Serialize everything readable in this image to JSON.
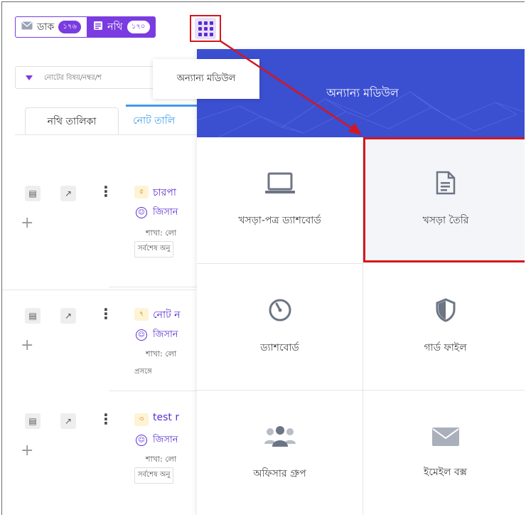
{
  "topbar": {
    "dak_label": "ডাক",
    "dak_count": "১৭৬",
    "nothi_label": "নথি",
    "nothi_count": "১৭০"
  },
  "search": {
    "placeholder": "নোটের বিষয়/নম্বর/শ"
  },
  "tabs": [
    {
      "label": "নথি তালিকা"
    },
    {
      "label": "নোট তালি"
    }
  ],
  "tooltip": {
    "text": "অন্যান্য মডিউল"
  },
  "notes": [
    {
      "num": "৫",
      "title": "চারপা",
      "person": "জিসান",
      "branch": "শাখা: লো",
      "last": "সর্বশেষ অনু"
    },
    {
      "num": "৭",
      "title": "নোট ন",
      "person": "জিসান",
      "branch": "শাখা: লো",
      "last": "প্রসঙ্গে"
    },
    {
      "num": "৩",
      "title": "test r",
      "person": "জিসান",
      "branch": "শাখা: লো",
      "last": "সর্বশেষ অনু"
    }
  ],
  "panel": {
    "title": "অন্যান্য মডিউল",
    "tiles": [
      {
        "label": "খসড়া-পত্র ড্যাশবোর্ড",
        "icon": "laptop-icon"
      },
      {
        "label": "খসড়া তৈরি",
        "icon": "document-icon"
      },
      {
        "label": "ড্যাশবোর্ড",
        "icon": "gauge-icon"
      },
      {
        "label": "গার্ড ফাইল",
        "icon": "shield-icon"
      },
      {
        "label": "অফিসার গ্রুপ",
        "icon": "group-icon"
      },
      {
        "label": "ইমেইল বক্স",
        "icon": "envelope-icon"
      }
    ]
  },
  "colors": {
    "accent": "#7a3ce0",
    "panel_header": "#3b4fd1",
    "highlight": "#d6161c",
    "tab_active": "#3d9be9"
  }
}
